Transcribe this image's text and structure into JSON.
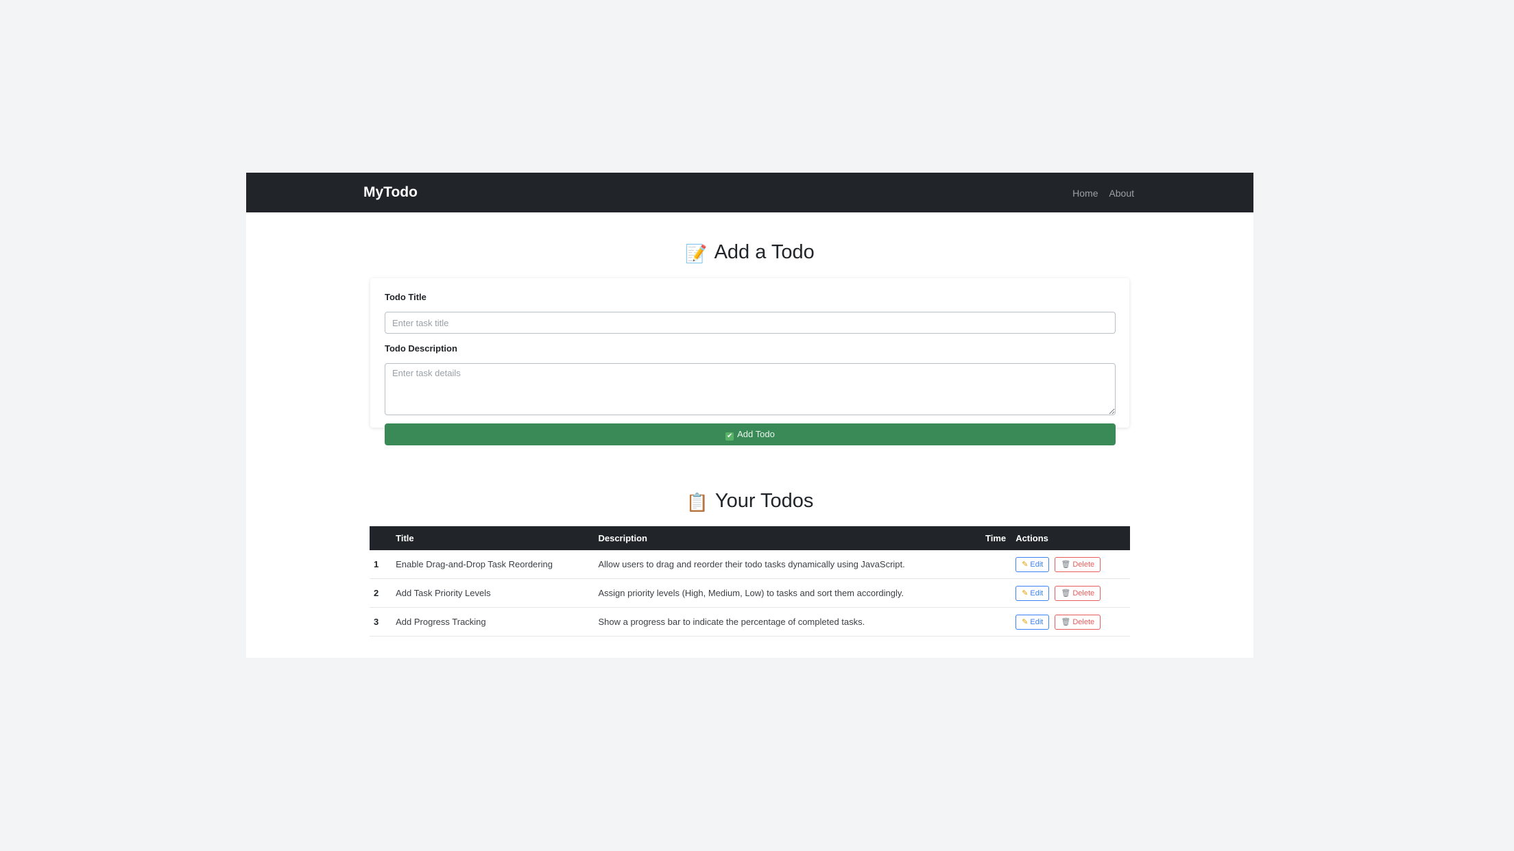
{
  "navbar": {
    "brand": "MyTodo",
    "links": [
      "Home",
      "About"
    ]
  },
  "add_section": {
    "heading": "Add a Todo",
    "heading_icon": "📝",
    "title_label": "Todo Title",
    "title_placeholder": "Enter task title",
    "title_value": "",
    "desc_label": "Todo Description",
    "desc_placeholder": "Enter task details",
    "desc_value": "",
    "add_button_label": "Add Todo",
    "add_button_icon": "✔",
    "button_color": "#3a8a58"
  },
  "list_section": {
    "heading": "Your Todos",
    "heading_icon": "📋",
    "columns": [
      "#",
      "Title",
      "Description",
      "Time",
      "Actions"
    ],
    "rows": [
      {
        "num": "1",
        "title": "Enable Drag-and-Drop Task Reordering",
        "description": "Allow users to drag and reorder their todo tasks dynamically using JavaScript.",
        "time": ""
      },
      {
        "num": "2",
        "title": "Add Task Priority Levels",
        "description": "Assign priority levels (High, Medium, Low) to tasks and sort them accordingly.",
        "time": ""
      },
      {
        "num": "3",
        "title": "Add Progress Tracking",
        "description": "Show a progress bar to indicate the percentage of completed tasks.",
        "time": ""
      }
    ],
    "edit_label": "Edit",
    "delete_label": "Delete",
    "edit_icon": "✎",
    "delete_icon": "🗑"
  }
}
